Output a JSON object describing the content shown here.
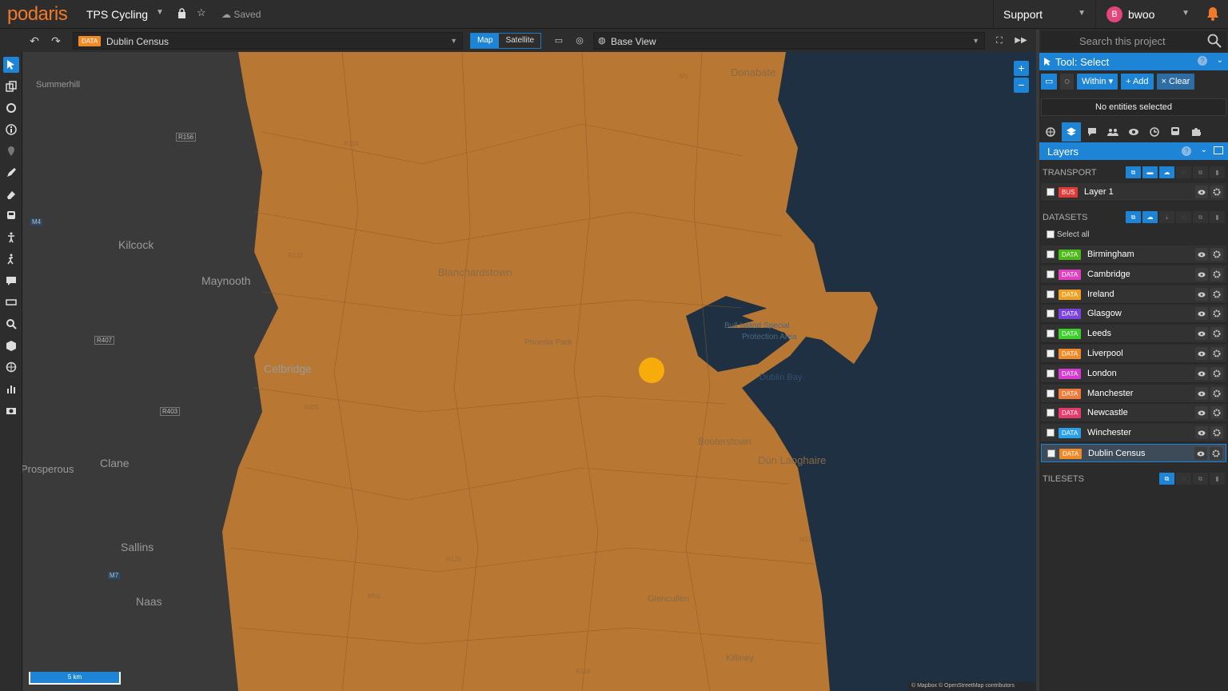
{
  "header": {
    "logo": "podaris",
    "project_title": "TPS Cycling",
    "saved_label": "Saved",
    "support_label": "Support",
    "user_initial": "B",
    "user_name": "bwoo"
  },
  "map_toolbar": {
    "data_badge": "DATA",
    "data_selected": "Dublin Census",
    "map_label": "Map",
    "satellite_label": "Satellite",
    "active_view": "Map",
    "base_view": "Base View"
  },
  "map": {
    "place_labels": [
      "Summerhill",
      "Kilcock",
      "Maynooth",
      "Clane",
      "Sallins",
      "Naas",
      "Donabate",
      "Bull Island Special",
      "Protection Area",
      "Dublin Bay",
      "Blanchardstown",
      "Phoenix Park",
      "Dún Laoghaire",
      "Celbridge",
      "Prosperous",
      "Glencullen",
      "Booterstown",
      "Killiney"
    ],
    "road_labels": [
      "R156",
      "M4",
      "R407",
      "R403",
      "M7",
      "R125",
      "M1",
      "R132",
      "R118",
      "R116",
      "M11",
      "M50",
      "R405"
    ],
    "scale_label": "5 km",
    "attribution": "© Mapbox © OpenStreetMap contributors",
    "colors": {
      "census": "#b87833",
      "water": "#1f3042",
      "land": "#3a3a3a",
      "marker": "#f8ac0c"
    }
  },
  "panel": {
    "search_placeholder": "Search this project",
    "tool_title": "Tool: Select",
    "within_label": "Within",
    "add_label": "+ Add",
    "clear_label": "× Clear",
    "no_selection": "No entities selected",
    "layers_title": "Layers",
    "transport_label": "TRANSPORT",
    "transport_layers": [
      {
        "badge": "BUS",
        "name": "Layer 1",
        "color": "#e53935"
      }
    ],
    "datasets_label": "DATASETS",
    "select_all_label": "Select all",
    "datasets": [
      {
        "badge": "DATA",
        "name": "Birmingham",
        "color": "#4cbb17"
      },
      {
        "badge": "DATA",
        "name": "Cambridge",
        "color": "#e040c0"
      },
      {
        "badge": "DATA",
        "name": "Ireland",
        "color": "#f0a020"
      },
      {
        "badge": "DATA",
        "name": "Glasgow",
        "color": "#7a42e0"
      },
      {
        "badge": "DATA",
        "name": "Leeds",
        "color": "#3ccf2a"
      },
      {
        "badge": "DATA",
        "name": "Liverpool",
        "color": "#f08a28"
      },
      {
        "badge": "DATA",
        "name": "London",
        "color": "#d63ad0"
      },
      {
        "badge": "DATA",
        "name": "Manchester",
        "color": "#f07a38"
      },
      {
        "badge": "DATA",
        "name": "Newcastle",
        "color": "#e83a6a"
      },
      {
        "badge": "DATA",
        "name": "Winchester",
        "color": "#2aa0e8"
      },
      {
        "badge": "DATA",
        "name": "Dublin Census",
        "color": "#f08a28",
        "selected": true
      }
    ],
    "tilesets_label": "TILESETS"
  }
}
